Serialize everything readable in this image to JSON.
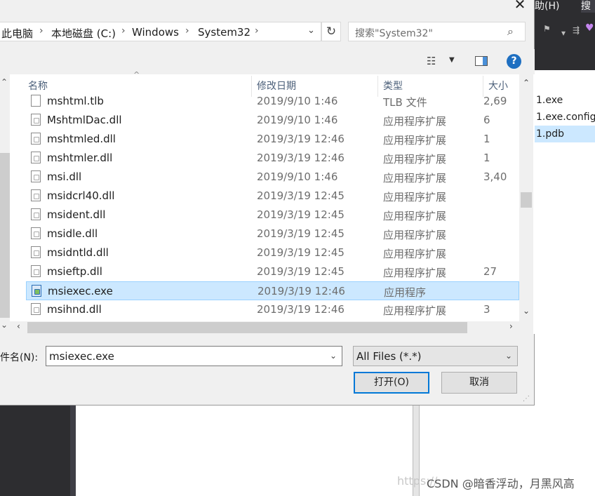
{
  "background_ide": {
    "menu_help": "助(H)",
    "menu_search": "搜",
    "solution_items": [
      "1.exe",
      "1.exe.config",
      "1.pdb"
    ],
    "solution_selected_index": 2,
    "watermark": "CSDN @暗香浮动，月黑风高",
    "watermark_faint": "https://"
  },
  "dialog": {
    "close_glyph": "✕",
    "breadcrumb": [
      "此电脑",
      "本地磁盘 (C:)",
      "Windows",
      "System32"
    ],
    "breadcrumb_separator": "›",
    "address_dropdown_glyph": "⌄",
    "refresh_glyph": "↻",
    "search_placeholder": "搜索\"System32\"",
    "search_icon_glyph": "⌕",
    "view_glyph": "☷",
    "view_drop_glyph": "▼",
    "help_glyph": "?",
    "columns": {
      "name": "名称",
      "date": "修改日期",
      "type": "类型",
      "size": "大小"
    },
    "sort_caret": "^",
    "files": [
      {
        "name": "mshtml.tlb",
        "date": "2019/9/10 1:46",
        "type": "TLB 文件",
        "size": "2,69",
        "icon": "tlb"
      },
      {
        "name": "MshtmlDac.dll",
        "date": "2019/9/10 1:46",
        "type": "应用程序扩展",
        "size": "6",
        "icon": "dll"
      },
      {
        "name": "mshtmled.dll",
        "date": "2019/3/19 12:46",
        "type": "应用程序扩展",
        "size": "1",
        "icon": "dll"
      },
      {
        "name": "mshtmler.dll",
        "date": "2019/3/19 12:46",
        "type": "应用程序扩展",
        "size": "1",
        "icon": "dll"
      },
      {
        "name": "msi.dll",
        "date": "2019/9/10 1:46",
        "type": "应用程序扩展",
        "size": "3,40",
        "icon": "dll"
      },
      {
        "name": "msidcrl40.dll",
        "date": "2019/3/19 12:45",
        "type": "应用程序扩展",
        "size": "",
        "icon": "dll"
      },
      {
        "name": "msident.dll",
        "date": "2019/3/19 12:45",
        "type": "应用程序扩展",
        "size": "",
        "icon": "dll"
      },
      {
        "name": "msidle.dll",
        "date": "2019/3/19 12:45",
        "type": "应用程序扩展",
        "size": "",
        "icon": "dll"
      },
      {
        "name": "msidntld.dll",
        "date": "2019/3/19 12:45",
        "type": "应用程序扩展",
        "size": "",
        "icon": "dll"
      },
      {
        "name": "msieftp.dll",
        "date": "2019/3/19 12:45",
        "type": "应用程序扩展",
        "size": "27",
        "icon": "dll"
      },
      {
        "name": "msiexec.exe",
        "date": "2019/3/19 12:46",
        "type": "应用程序",
        "size": "",
        "icon": "exe"
      },
      {
        "name": "msihnd.dll",
        "date": "2019/3/19 12:46",
        "type": "应用程序扩展",
        "size": "3",
        "icon": "dll"
      }
    ],
    "selected_file_index": 10,
    "filename_label": "文件名(N):",
    "filename_value": "msiexec.exe",
    "filename_drop_glyph": "⌄",
    "filter_value": "All Files (*.*)",
    "filter_drop_glyph": "⌄",
    "open_button": "打开(O)",
    "cancel_button": "取消",
    "scroll_up": "⌃",
    "scroll_down": "⌄",
    "scroll_left": "‹",
    "scroll_right": "›",
    "grip_glyph": "⋰"
  }
}
